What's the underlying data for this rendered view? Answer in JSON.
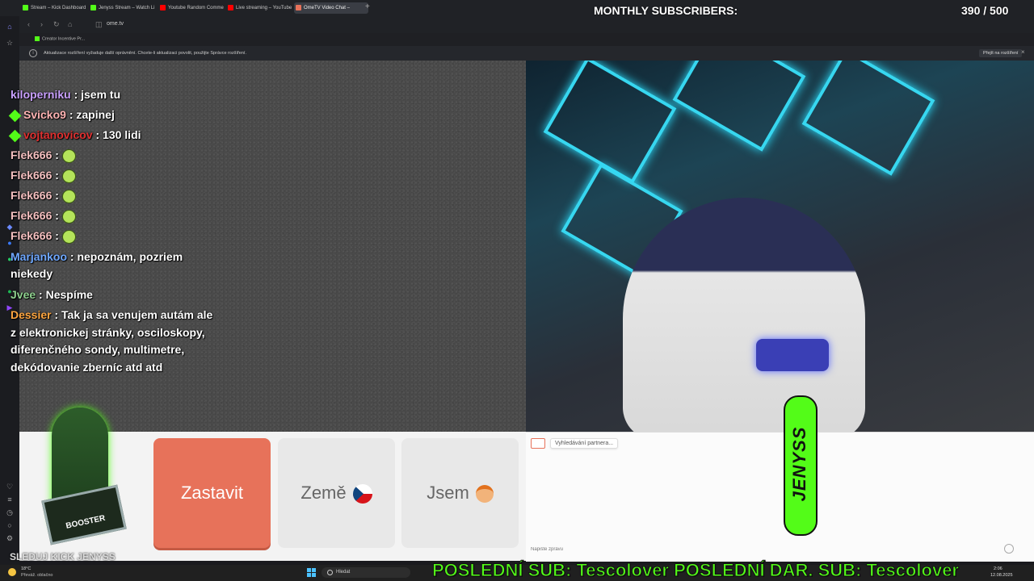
{
  "tabs": [
    {
      "label": "Stream – Kick Dashboard",
      "color": "#53fc18"
    },
    {
      "label": "Jenyss Stream – Watch Li",
      "color": "#53fc18"
    },
    {
      "label": "Youtube Random Comme",
      "color": "#ff0000"
    },
    {
      "label": "Live streaming – YouTube",
      "color": "#ff0000"
    },
    {
      "label": "OmeTV Video Chat –",
      "color": "#e7725a"
    }
  ],
  "address": {
    "url": "ome.tv"
  },
  "bookmarks": [
    {
      "label": "Creator Incentive Pr..."
    }
  ],
  "notice": {
    "text": "Aktualizace rozšíření vyžaduje další oprávnění. Chcete-li aktualizaci povolit, použijte Správce rozšíření.",
    "button": "Přejít na rozšíření"
  },
  "overlay": {
    "subs_title": "MONTHLY SUBSCRIBERS:",
    "subs_count": "390 / 500",
    "subs_current": 390,
    "subs_goal": 500,
    "accent": "#53fc18"
  },
  "chat": {
    "messages": [
      {
        "user": "kiloperniku",
        "user_color": "#c9a0ff",
        "text": " : jsem tu",
        "badge": false,
        "emote": false
      },
      {
        "user": "Svicko9",
        "user_color": "#ffb3b3",
        "text": " : zapinej",
        "badge": true,
        "emote": false
      },
      {
        "user": "vojtanovicov",
        "user_color": "#e03030",
        "text": " : 130 lidi",
        "badge": true,
        "emote": false
      },
      {
        "user": "Flek666",
        "user_color": "#f5c0c0",
        "text": " :",
        "badge": false,
        "emote": true
      },
      {
        "user": "Flek666",
        "user_color": "#f5c0c0",
        "text": " :",
        "badge": false,
        "emote": true
      },
      {
        "user": "Flek666",
        "user_color": "#f5c0c0",
        "text": " :",
        "badge": false,
        "emote": true
      },
      {
        "user": "Flek666",
        "user_color": "#f5c0c0",
        "text": " :",
        "badge": false,
        "emote": true
      },
      {
        "user": "Flek666",
        "user_color": "#f5c0c0",
        "text": " :",
        "badge": false,
        "emote": true
      },
      {
        "user": "Marjankoo",
        "user_color": "#6fa8ff",
        "text": " : nepoznám, pozriem",
        "badge": false,
        "emote": false
      },
      {
        "user": "",
        "user_color": "#ffffff",
        "text": "niekedy",
        "badge": false,
        "emote": false
      },
      {
        "user": "Jvee",
        "user_color": "#8fd08f",
        "text": " : Nespíme",
        "badge": false,
        "emote": false
      },
      {
        "user": "Dessier",
        "user_color": "#ffa640",
        "text": " : Tak ja sa venujem autám ale",
        "badge": false,
        "emote": false
      },
      {
        "user": "",
        "user_color": "#ffffff",
        "text": "z elektronickej stránky, osciloskopy,",
        "badge": false,
        "emote": false
      },
      {
        "user": "",
        "user_color": "#ffffff",
        "text": "diferenčného sondy, multimetre,",
        "badge": false,
        "emote": false
      },
      {
        "user": "",
        "user_color": "#ffffff",
        "text": "dekódovanie zberníc atd atd",
        "badge": false,
        "emote": false
      }
    ]
  },
  "controls": {
    "stop_label": "Zastavit",
    "country_label": "Země",
    "iam_label": "Jsem"
  },
  "chat_panel": {
    "status": "Vyhledávání partnera...",
    "input_placeholder": "Napište zprávu"
  },
  "jenyss_logo": "JENYSS",
  "booster": {
    "badge": "BOOSTER",
    "name": "SLEDUJ KICK JENYSS"
  },
  "ticker": "POSLEDNÍ SUB: Tescolover POSLEDNÍ DAR. SUB: Tescolover",
  "taskbar": {
    "weather_temp": "18°C",
    "weather_desc": "Převáž. oblačno",
    "search_label": "Hledat",
    "time": "2:06",
    "date": "12.08.2025"
  }
}
